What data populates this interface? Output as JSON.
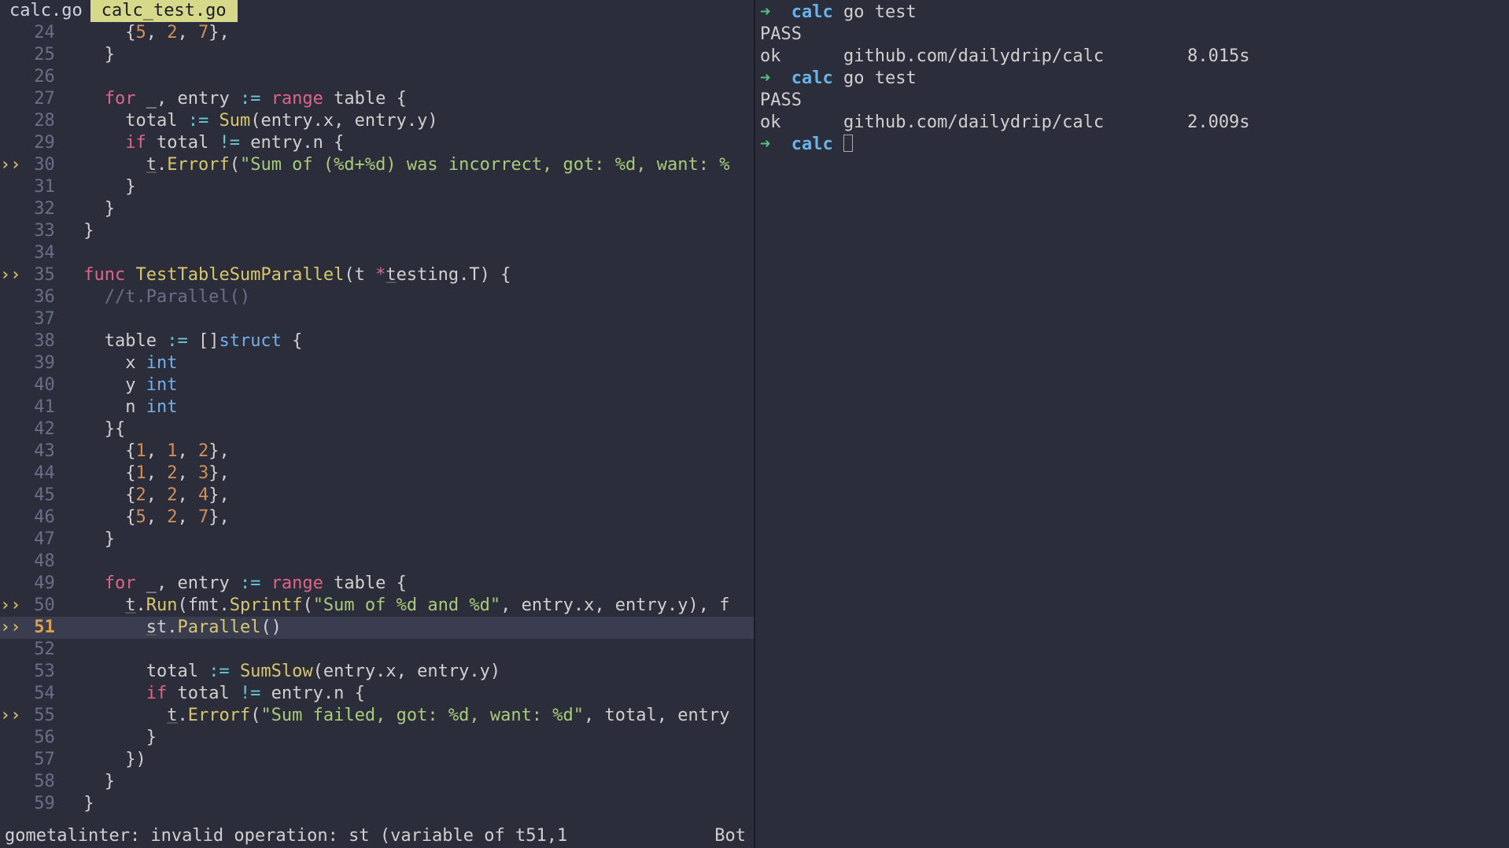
{
  "tabs": [
    {
      "label": "calc.go",
      "active": false
    },
    {
      "label": "calc_test.go",
      "active": true
    }
  ],
  "status": {
    "left": "gometalinter: invalid operation: st (variable of t51,1",
    "right": "Bot"
  },
  "terminal": [
    {
      "arrow": "➜",
      "cwd": "calc",
      "cmd": "go test"
    },
    {
      "plain": "PASS"
    },
    {
      "ok": "ok",
      "pkg": "github.com/dailydrip/calc",
      "time": "8.015s"
    },
    {
      "arrow": "➜",
      "cwd": "calc",
      "cmd": "go test"
    },
    {
      "plain": "PASS"
    },
    {
      "ok": "ok",
      "pkg": "github.com/dailydrip/calc",
      "time": "2.009s"
    },
    {
      "arrow": "➜",
      "cwd": "calc",
      "cursor": true
    }
  ],
  "lines": [
    {
      "n": 24,
      "sign": "",
      "seg": [
        [
          "punc",
          "      {"
        ],
        [
          "num",
          "5"
        ],
        [
          "punc",
          ", "
        ],
        [
          "num",
          "2"
        ],
        [
          "punc",
          ", "
        ],
        [
          "num",
          "7"
        ],
        [
          "punc",
          "},"
        ]
      ]
    },
    {
      "n": 25,
      "sign": "",
      "seg": [
        [
          "punc",
          "    }"
        ]
      ]
    },
    {
      "n": 26,
      "sign": "",
      "seg": [
        [
          "id",
          ""
        ]
      ]
    },
    {
      "n": 27,
      "sign": "",
      "seg": [
        [
          "id",
          "    "
        ],
        [
          "kw",
          "for"
        ],
        [
          "id",
          " _, entry "
        ],
        [
          "op",
          ":="
        ],
        [
          "id",
          " "
        ],
        [
          "kw",
          "range"
        ],
        [
          "id",
          " table {"
        ]
      ]
    },
    {
      "n": 28,
      "sign": "",
      "seg": [
        [
          "id",
          "      total "
        ],
        [
          "op",
          ":="
        ],
        [
          "id",
          " "
        ],
        [
          "fn",
          "Sum"
        ],
        [
          "punc",
          "(entry.x, entry.y)"
        ]
      ]
    },
    {
      "n": 29,
      "sign": "",
      "seg": [
        [
          "id",
          "      "
        ],
        [
          "kw",
          "if"
        ],
        [
          "id",
          " total "
        ],
        [
          "op",
          "!="
        ],
        [
          "id",
          " entry.n {"
        ]
      ]
    },
    {
      "n": 30,
      "sign": "››",
      "seg": [
        [
          "id",
          "        "
        ],
        [
          "underline",
          "t"
        ],
        [
          "punc",
          "."
        ],
        [
          "fn",
          "Errorf"
        ],
        [
          "punc",
          "("
        ],
        [
          "str",
          "\"Sum of (%d+%d) was incorrect, got: %d, want: %"
        ]
      ]
    },
    {
      "n": 31,
      "sign": "",
      "seg": [
        [
          "punc",
          "      }"
        ]
      ]
    },
    {
      "n": 32,
      "sign": "",
      "seg": [
        [
          "punc",
          "    }"
        ]
      ]
    },
    {
      "n": 33,
      "sign": "",
      "seg": [
        [
          "punc",
          "  }"
        ]
      ]
    },
    {
      "n": 34,
      "sign": "",
      "seg": [
        [
          "id",
          ""
        ]
      ]
    },
    {
      "n": 35,
      "sign": "››",
      "seg": [
        [
          "id",
          "  "
        ],
        [
          "kw",
          "func"
        ],
        [
          "id",
          " "
        ],
        [
          "fname",
          "TestTableSumParallel"
        ],
        [
          "punc",
          "(t "
        ],
        [
          "star",
          "*"
        ],
        [
          "underline",
          "t"
        ],
        [
          "id",
          "esting.T) {"
        ]
      ]
    },
    {
      "n": 36,
      "sign": "",
      "seg": [
        [
          "cmt",
          "    //t.Parallel()"
        ]
      ]
    },
    {
      "n": 37,
      "sign": "",
      "seg": [
        [
          "id",
          ""
        ]
      ]
    },
    {
      "n": 38,
      "sign": "",
      "seg": [
        [
          "id",
          "    table "
        ],
        [
          "op",
          ":="
        ],
        [
          "id",
          " []"
        ],
        [
          "type",
          "struct"
        ],
        [
          "id",
          " {"
        ]
      ]
    },
    {
      "n": 39,
      "sign": "",
      "seg": [
        [
          "id",
          "      x "
        ],
        [
          "type",
          "int"
        ]
      ]
    },
    {
      "n": 40,
      "sign": "",
      "seg": [
        [
          "id",
          "      y "
        ],
        [
          "type",
          "int"
        ]
      ]
    },
    {
      "n": 41,
      "sign": "",
      "seg": [
        [
          "id",
          "      n "
        ],
        [
          "type",
          "int"
        ]
      ]
    },
    {
      "n": 42,
      "sign": "",
      "seg": [
        [
          "punc",
          "    }{"
        ]
      ]
    },
    {
      "n": 43,
      "sign": "",
      "seg": [
        [
          "punc",
          "      {"
        ],
        [
          "num",
          "1"
        ],
        [
          "punc",
          ", "
        ],
        [
          "num",
          "1"
        ],
        [
          "punc",
          ", "
        ],
        [
          "num",
          "2"
        ],
        [
          "punc",
          "},"
        ]
      ]
    },
    {
      "n": 44,
      "sign": "",
      "seg": [
        [
          "punc",
          "      {"
        ],
        [
          "num",
          "1"
        ],
        [
          "punc",
          ", "
        ],
        [
          "num",
          "2"
        ],
        [
          "punc",
          ", "
        ],
        [
          "num",
          "3"
        ],
        [
          "punc",
          "},"
        ]
      ]
    },
    {
      "n": 45,
      "sign": "",
      "seg": [
        [
          "punc",
          "      {"
        ],
        [
          "num",
          "2"
        ],
        [
          "punc",
          ", "
        ],
        [
          "num",
          "2"
        ],
        [
          "punc",
          ", "
        ],
        [
          "num",
          "4"
        ],
        [
          "punc",
          "},"
        ]
      ]
    },
    {
      "n": 46,
      "sign": "",
      "seg": [
        [
          "punc",
          "      {"
        ],
        [
          "num",
          "5"
        ],
        [
          "punc",
          ", "
        ],
        [
          "num",
          "2"
        ],
        [
          "punc",
          ", "
        ],
        [
          "num",
          "7"
        ],
        [
          "punc",
          "},"
        ]
      ]
    },
    {
      "n": 47,
      "sign": "",
      "seg": [
        [
          "punc",
          "    }"
        ]
      ]
    },
    {
      "n": 48,
      "sign": "",
      "seg": [
        [
          "id",
          ""
        ]
      ]
    },
    {
      "n": 49,
      "sign": "",
      "seg": [
        [
          "id",
          "    "
        ],
        [
          "kw",
          "for"
        ],
        [
          "id",
          " _, entry "
        ],
        [
          "op",
          ":="
        ],
        [
          "id",
          " "
        ],
        [
          "kw",
          "range"
        ],
        [
          "id",
          " table {"
        ]
      ]
    },
    {
      "n": 50,
      "sign": "››",
      "seg": [
        [
          "id",
          "      "
        ],
        [
          "underline",
          "t"
        ],
        [
          "punc",
          "."
        ],
        [
          "fn",
          "Run"
        ],
        [
          "punc",
          "(fmt."
        ],
        [
          "fn",
          "Sprintf"
        ],
        [
          "punc",
          "("
        ],
        [
          "str",
          "\"Sum of %d and %d\""
        ],
        [
          "punc",
          ", entry.x, entry.y), f"
        ]
      ]
    },
    {
      "n": 51,
      "sign": "››",
      "current": true,
      "seg": [
        [
          "id",
          "        "
        ],
        [
          "underline",
          "s"
        ],
        [
          "id",
          "t."
        ],
        [
          "fn",
          "Parallel"
        ],
        [
          "punc",
          "()"
        ]
      ]
    },
    {
      "n": 52,
      "sign": "",
      "seg": [
        [
          "id",
          ""
        ]
      ]
    },
    {
      "n": 53,
      "sign": "",
      "seg": [
        [
          "id",
          "        total "
        ],
        [
          "op",
          ":="
        ],
        [
          "id",
          " "
        ],
        [
          "fn",
          "SumSlow"
        ],
        [
          "punc",
          "(entry.x, entry.y)"
        ]
      ]
    },
    {
      "n": 54,
      "sign": "",
      "seg": [
        [
          "id",
          "        "
        ],
        [
          "kw",
          "if"
        ],
        [
          "id",
          " total "
        ],
        [
          "op",
          "!="
        ],
        [
          "id",
          " entry.n {"
        ]
      ]
    },
    {
      "n": 55,
      "sign": "››",
      "seg": [
        [
          "id",
          "          "
        ],
        [
          "underline",
          "t"
        ],
        [
          "punc",
          "."
        ],
        [
          "fn",
          "Errorf"
        ],
        [
          "punc",
          "("
        ],
        [
          "str",
          "\"Sum failed, got: %d, want: %d\""
        ],
        [
          "punc",
          ", total, entry"
        ]
      ]
    },
    {
      "n": 56,
      "sign": "",
      "seg": [
        [
          "punc",
          "        }"
        ]
      ]
    },
    {
      "n": 57,
      "sign": "",
      "seg": [
        [
          "punc",
          "      })"
        ]
      ]
    },
    {
      "n": 58,
      "sign": "",
      "seg": [
        [
          "punc",
          "    }"
        ]
      ]
    },
    {
      "n": 59,
      "sign": "",
      "seg": [
        [
          "punc",
          "  }"
        ]
      ]
    }
  ]
}
